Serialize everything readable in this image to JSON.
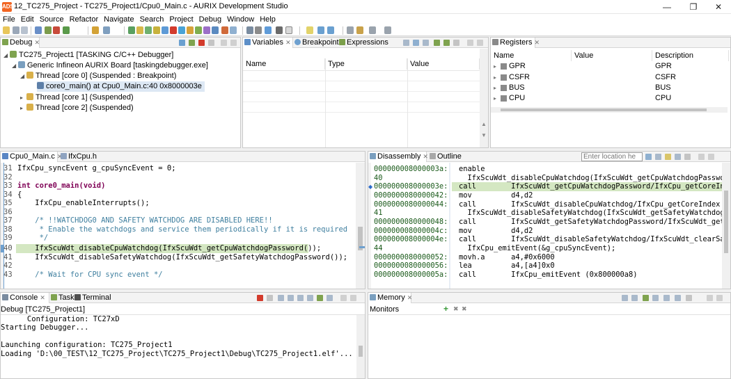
{
  "window": {
    "title": "12_TC275_Project - TC275_Project1/Cpu0_Main.c - AURIX Development Studio"
  },
  "menu": [
    "File",
    "Edit",
    "Source",
    "Refactor",
    "Navigate",
    "Search",
    "Project",
    "Debug",
    "Window",
    "Help"
  ],
  "debug_view": {
    "tab": "Debug",
    "tree": [
      "TC275_Project1 [TASKING C/C++ Debugger]",
      "Generic Infineon AURIX Board [taskingdebugger.exe]",
      "Thread [core 0] (Suspended : Breakpoint)",
      "core0_main() at Cpu0_Main.c:40 0x8000003e",
      "Thread [core 1] (Suspended)",
      "Thread [core 2] (Suspended)"
    ]
  },
  "variables_view": {
    "tabs": [
      "Variables",
      "Breakpoints",
      "Expressions"
    ],
    "columns": [
      "Name",
      "Type",
      "Value"
    ]
  },
  "registers_view": {
    "tab": "Registers",
    "columns": [
      "Name",
      "Value",
      "Description"
    ],
    "rows": [
      {
        "name": "GPR",
        "description": "GPR"
      },
      {
        "name": "CSFR",
        "description": "CSFR"
      },
      {
        "name": "BUS",
        "description": "BUS"
      },
      {
        "name": "CPU",
        "description": "CPU"
      }
    ]
  },
  "editor": {
    "tabs": [
      "Cpu0_Main.c",
      "IfxCpu.h"
    ],
    "lines": [
      {
        "num": "31",
        "text": "IfxCpu_syncEvent g_cpuSyncEvent = 0;"
      },
      {
        "num": "32",
        "text": ""
      },
      {
        "num": "33",
        "text": "int core0_main(void)"
      },
      {
        "num": "34",
        "text": "{"
      },
      {
        "num": "35",
        "text": "    IfxCpu_enableInterrupts();"
      },
      {
        "num": "36",
        "text": ""
      },
      {
        "num": "37",
        "text": "    /* !!WATCHDOG0 AND SAFETY WATCHDOG ARE DISABLED HERE!!"
      },
      {
        "num": "38",
        "text": "     * Enable the watchdogs and service them periodically if it is required"
      },
      {
        "num": "39",
        "text": "     */"
      },
      {
        "num": "40",
        "text": "    IfxScuWdt_disableCpuWatchdog(IfxScuWdt_getCpuWatchdogPassword());"
      },
      {
        "num": "41",
        "text": "    IfxScuWdt_disableSafetyWatchdog(IfxScuWdt_getSafetyWatchdogPassword());"
      },
      {
        "num": "42",
        "text": ""
      },
      {
        "num": "43",
        "text": "    /* Wait for CPU sync event */"
      }
    ]
  },
  "disassembly": {
    "tabs": [
      "Disassembly",
      "Outline"
    ],
    "location_placeholder": "Enter location he",
    "lines": [
      {
        "addr": "000000008000003a:",
        "instr": "enable"
      },
      {
        "addr": "40",
        "instr": "  IfxScuWdt_disableCpuWatchdog(IfxScuWdt_getCpuWatchdogPasswo"
      },
      {
        "addr": "000000008000003e:",
        "instr": "call        IfxScuWdt_getCpuWatchdogPassword/IfxCpu_getCoreInd"
      },
      {
        "addr": "0000000080000042:",
        "instr": "mov         d4,d2"
      },
      {
        "addr": "0000000080000044:",
        "instr": "call        IfxScuWdt_disableCpuWatchdog/IfxCpu_getCoreIndex ("
      },
      {
        "addr": "41",
        "instr": "  IfxScuWdt_disableSafetyWatchdog(IfxScuWdt_getSafetyWatchdogP"
      },
      {
        "addr": "0000000080000048:",
        "instr": "call        IfxScuWdt_getSafetyWatchdogPassword/IfxScuWdt_getS"
      },
      {
        "addr": "000000008000004c:",
        "instr": "mov         d4,d2"
      },
      {
        "addr": "000000008000004e:",
        "instr": "call        IfxScuWdt_disableSafetyWatchdog/IfxScuWdt_clearSaf"
      },
      {
        "addr": "44",
        "instr": "  IfxCpu_emitEvent(&g_cpuSyncEvent);"
      },
      {
        "addr": "0000000080000052:",
        "instr": "movh.a      a4,#0x6000"
      },
      {
        "addr": "0000000080000056:",
        "instr": "lea         a4,[a4]0x0"
      },
      {
        "addr": "000000008000005a:",
        "instr": "call        IfxCpu_emitEvent (0x800000a8)"
      }
    ]
  },
  "console": {
    "tabs": [
      "Console",
      "Tasks",
      "Terminal"
    ],
    "header": "Debug [TC275_Project1]",
    "lines": [
      "      Configuration: TC27xD",
      "Starting Debugger...",
      "",
      "Launching configuration: TC275_Project1",
      "Loading 'D:\\00_TEST\\12_TC275_Project\\TC275_Project1\\Debug\\TC275_Project1.elf'..."
    ]
  },
  "memory_view": {
    "tab": "Memory",
    "section": "Monitors"
  },
  "colors": {
    "highlight": "#d4e7c2",
    "breakpoint": "#6ea0cf",
    "accent": "#f26522"
  }
}
